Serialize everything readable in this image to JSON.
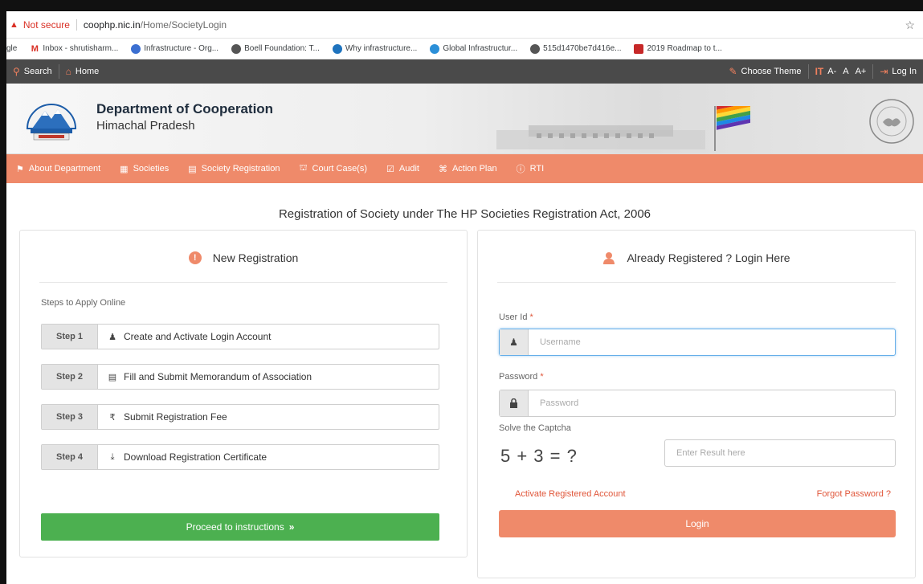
{
  "browser": {
    "security_label": "Not secure",
    "url_host": "coophp.nic.in",
    "url_path": "/Home/SocietyLogin",
    "bookmarks": [
      "gle",
      "Inbox - shrutisharm...",
      "Infrastructure - Org...",
      "Boell Foundation: T...",
      "Why infrastructure...",
      "Global Infrastructur...",
      "515d1470be7d416e...",
      "2019 Roadmap to t..."
    ]
  },
  "topbar": {
    "search": "Search",
    "home": "Home",
    "choose_theme": "Choose Theme",
    "font_small": "A-",
    "font_normal": "A",
    "font_large": "A+",
    "login": "Log In"
  },
  "header": {
    "dept": "Department of Cooperation",
    "state": "Himachal Pradesh"
  },
  "nav": [
    "About Department",
    "Societies",
    "Society Registration",
    "Court Case(s)",
    "Audit",
    "Action Plan",
    "RTI"
  ],
  "page_title": "Registration of Society under The HP Societies Registration Act, 2006",
  "new_registration": {
    "title": "New Registration",
    "steps_label": "Steps to Apply Online",
    "steps": [
      {
        "tag": "Step 1",
        "text": "Create and Activate Login Account"
      },
      {
        "tag": "Step 2",
        "text": "Fill and Submit Memorandum of Association"
      },
      {
        "tag": "Step 3",
        "text": "Submit Registration Fee"
      },
      {
        "tag": "Step 4",
        "text": "Download Registration Certificate"
      }
    ],
    "proceed": "Proceed to instructions"
  },
  "login": {
    "title": "Already Registered ? Login Here",
    "userid_label": "User Id",
    "username_placeholder": "Username",
    "password_label": "Password",
    "password_placeholder": "Password",
    "captcha_label": "Solve the Captcha",
    "captcha_question": "5 + 3 = ?",
    "captcha_placeholder": "Enter Result here",
    "activate_link": "Activate Registered Account",
    "forgot_link": "Forgot Password ?",
    "login_button": "Login"
  },
  "colors": {
    "accent": "#ef8a6a",
    "topbar": "#4a4a4a",
    "proceed_green": "#4cb050"
  }
}
